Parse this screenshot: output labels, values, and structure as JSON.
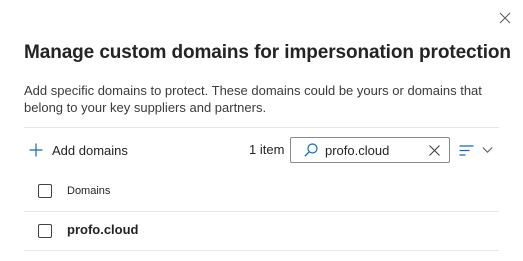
{
  "dialog": {
    "title": "Manage custom domains for impersonation protection",
    "description": "Add specific domains to protect. These domains could be yours or domains that belong to your key suppliers and partners."
  },
  "toolbar": {
    "add_label": "Add domains",
    "item_count": "1 item",
    "search": {
      "value": "profo.cloud"
    }
  },
  "table": {
    "column_header": "Domains",
    "rows": [
      {
        "domain": "profo.cloud"
      }
    ]
  },
  "icons": {
    "close": "close-icon",
    "add": "plus-icon",
    "search": "search-icon",
    "clear": "clear-icon",
    "sort": "sort-lines-icon",
    "dropdown": "chevron-down-icon"
  },
  "colors": {
    "accent": "#0f6cbd",
    "text": "#242424",
    "divider": "#e6e6e6"
  }
}
